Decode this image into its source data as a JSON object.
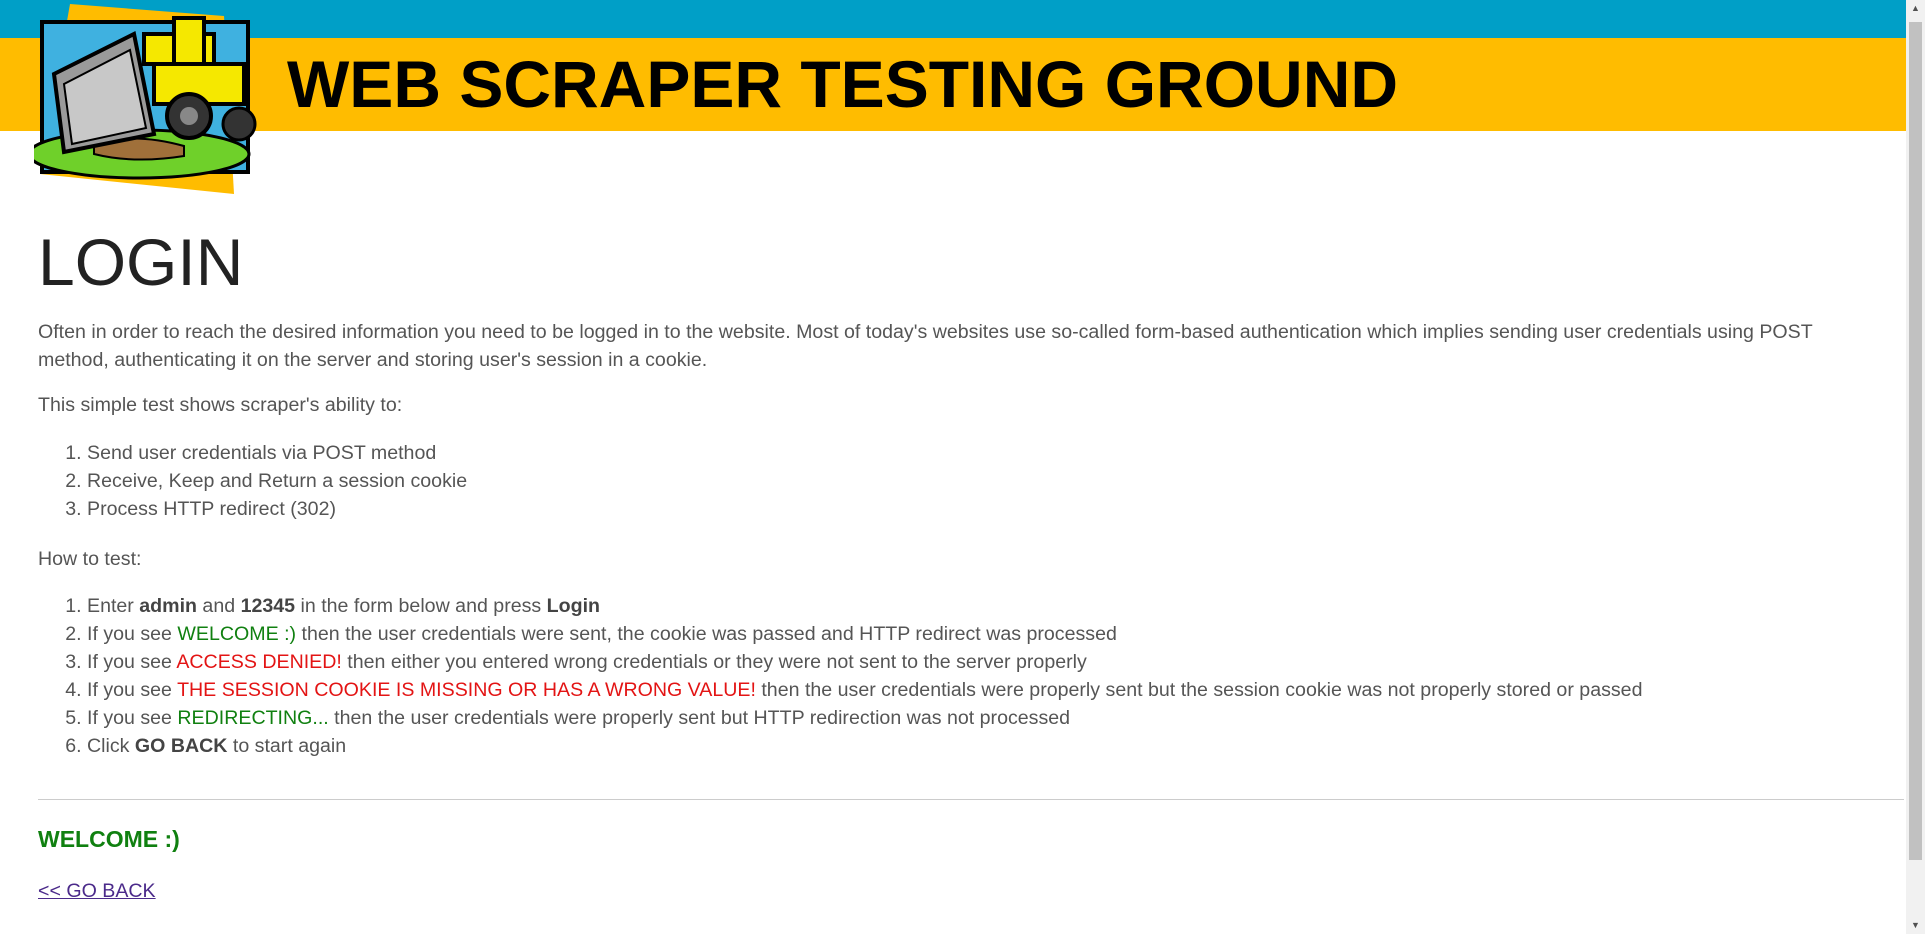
{
  "header": {
    "site_title": "WEB SCRAPER TESTING GROUND",
    "logo_icon": "bulldozer-icon"
  },
  "main": {
    "title": "LOGIN",
    "intro": "Often in order to reach the desired information you need to be logged in to the website. Most of today's websites use so-called form-based authentication which implies sending user credentials using POST method, authenticating it on the server and storing user's session in a cookie.",
    "ability_heading": "This simple test shows scraper's ability to:",
    "abilities": [
      "Send user credentials via POST method",
      "Receive, Keep and Return a session cookie",
      "Process HTTP redirect (302)"
    ],
    "howto_heading": "How to test:",
    "steps": {
      "s1": {
        "a": "Enter ",
        "b1": "admin",
        "c": " and ",
        "b2": "12345",
        "d": " in the form below and press ",
        "b3": "Login"
      },
      "s2": {
        "a": "If you see ",
        "hl": "WELCOME :)",
        "rest": " then the user credentials were sent, the cookie was passed and HTTP redirect was processed"
      },
      "s3": {
        "a": "If you see ",
        "hl": "ACCESS DENIED!",
        "rest": " then either you entered wrong credentials or they were not sent to the server properly"
      },
      "s4": {
        "a": "If you see ",
        "hl": "THE SESSION COOKIE IS MISSING OR HAS A WRONG VALUE!",
        "rest": " then the user credentials were properly sent but the session cookie was not properly stored or passed"
      },
      "s5": {
        "a": "If you see ",
        "hl": "REDIRECTING...",
        "rest": " then the user credentials were properly sent but HTTP redirection was not processed"
      },
      "s6": {
        "a": "Click ",
        "b": "GO BACK",
        "rest": " to start again"
      }
    },
    "result": "WELCOME :)",
    "go_back": "<< GO BACK"
  },
  "colors": {
    "topbar": "#009fc7",
    "banner": "#ffbc00",
    "success": "#108010",
    "error": "#e31414",
    "link_visited": "#4b2a8a"
  }
}
